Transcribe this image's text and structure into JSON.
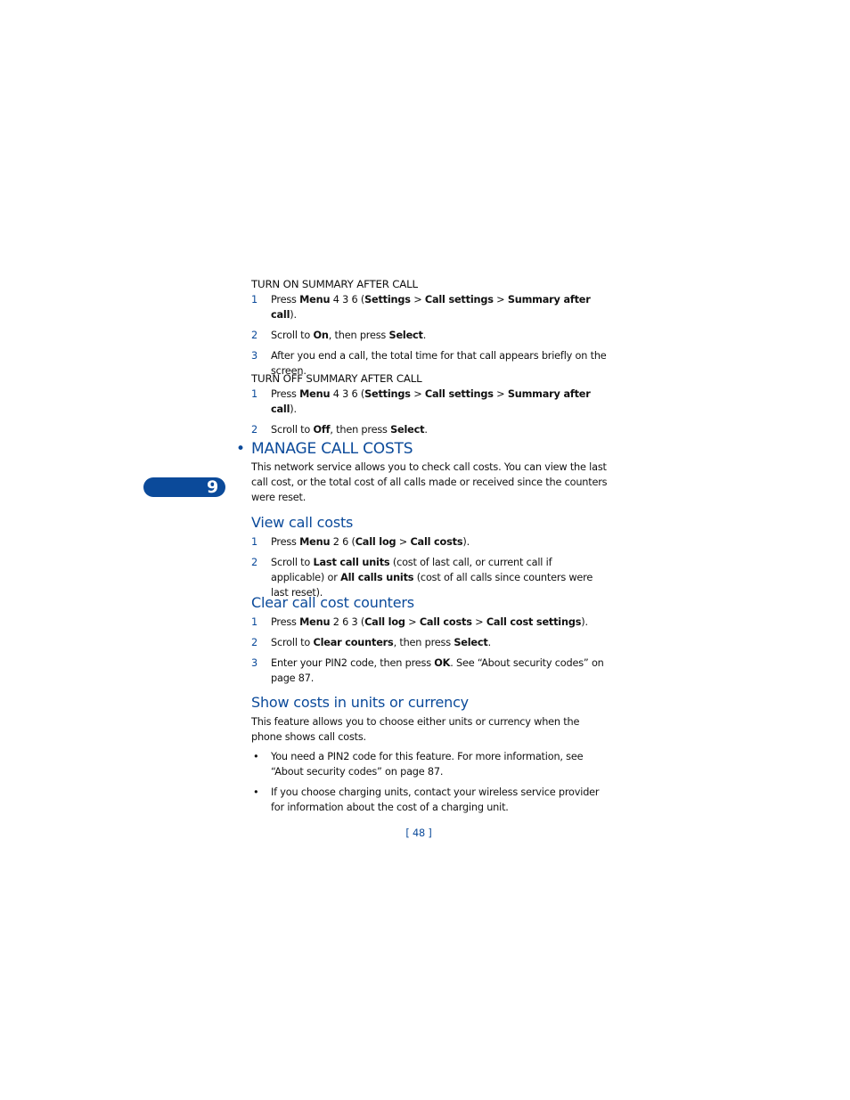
{
  "sections": [
    {
      "id": "on",
      "title": "TURN ON SUMMARY AFTER CALL",
      "steps": [
        [
          {
            "t": "Press "
          },
          {
            "t": "Menu",
            "b": 1
          },
          {
            "t": " 4 3 6 ("
          },
          {
            "t": "Settings",
            "b": 1
          },
          {
            "t": " > "
          },
          {
            "t": "Call settings",
            "b": 1
          },
          {
            "t": " > "
          },
          {
            "t": "Summary after call",
            "b": 1
          },
          {
            "t": ")."
          }
        ],
        [
          {
            "t": "Scroll to "
          },
          {
            "t": "On",
            "b": 1
          },
          {
            "t": ", then press "
          },
          {
            "t": "Select",
            "b": 1
          },
          {
            "t": "."
          }
        ],
        [
          {
            "t": "After you end a call, the total time for that call appears briefly on the screen."
          }
        ]
      ]
    },
    {
      "id": "off",
      "title": "TURN OFF SUMMARY AFTER CALL",
      "steps": [
        [
          {
            "t": "Press "
          },
          {
            "t": "Menu",
            "b": 1
          },
          {
            "t": " 4 3 6 ("
          },
          {
            "t": "Settings",
            "b": 1
          },
          {
            "t": " > "
          },
          {
            "t": "Call settings",
            "b": 1
          },
          {
            "t": " > "
          },
          {
            "t": "Summary after call",
            "b": 1
          },
          {
            "t": ")."
          }
        ],
        [
          {
            "t": "Scroll to "
          },
          {
            "t": "Off",
            "b": 1
          },
          {
            "t": ", then press "
          },
          {
            "t": "Select",
            "b": 1
          },
          {
            "t": "."
          }
        ]
      ]
    }
  ],
  "manage": {
    "title": "MANAGE CALL COSTS",
    "intro": "This network service allows you to check call costs. You can view the last call cost, or the total cost of all calls made or received since the counters were reset."
  },
  "chapter_tab": "9",
  "view": {
    "title": "View call costs",
    "steps": [
      [
        {
          "t": "Press "
        },
        {
          "t": "Menu",
          "b": 1
        },
        {
          "t": " 2 6 ("
        },
        {
          "t": "Call log",
          "b": 1
        },
        {
          "t": " > "
        },
        {
          "t": "Call costs",
          "b": 1
        },
        {
          "t": ")."
        }
      ],
      [
        {
          "t": "Scroll to "
        },
        {
          "t": "Last call units",
          "b": 1
        },
        {
          "t": " (cost of last call, or current call if applicable) or "
        },
        {
          "t": "All calls units",
          "b": 1
        },
        {
          "t": " (cost of all calls since counters were last reset)."
        }
      ]
    ]
  },
  "clear": {
    "title": "Clear call cost counters",
    "steps": [
      [
        {
          "t": "Press "
        },
        {
          "t": "Menu",
          "b": 1
        },
        {
          "t": " 2 6 3 ("
        },
        {
          "t": "Call log",
          "b": 1
        },
        {
          "t": " > "
        },
        {
          "t": "Call costs",
          "b": 1
        },
        {
          "t": " > "
        },
        {
          "t": "Call cost settings",
          "b": 1
        },
        {
          "t": ")."
        }
      ],
      [
        {
          "t": "Scroll to "
        },
        {
          "t": "Clear counters",
          "b": 1
        },
        {
          "t": ", then press "
        },
        {
          "t": "Select",
          "b": 1
        },
        {
          "t": "."
        }
      ],
      [
        {
          "t": "Enter your PIN2 code, then press "
        },
        {
          "t": "OK",
          "b": 1
        },
        {
          "t": ". See “About security codes” on page 87."
        }
      ]
    ]
  },
  "show": {
    "title": "Show costs in units or currency",
    "intro": "This feature allows you to choose either units or currency when the phone shows call costs.",
    "bullets": [
      "You need a PIN2 code for this feature. For more information, see “About security codes” on page 87.",
      "If you choose charging units, contact your wireless service provider for information about the cost of a charging unit."
    ]
  },
  "page_number": "[ 48 ]",
  "colors": {
    "accent": "#0b4a9a"
  }
}
